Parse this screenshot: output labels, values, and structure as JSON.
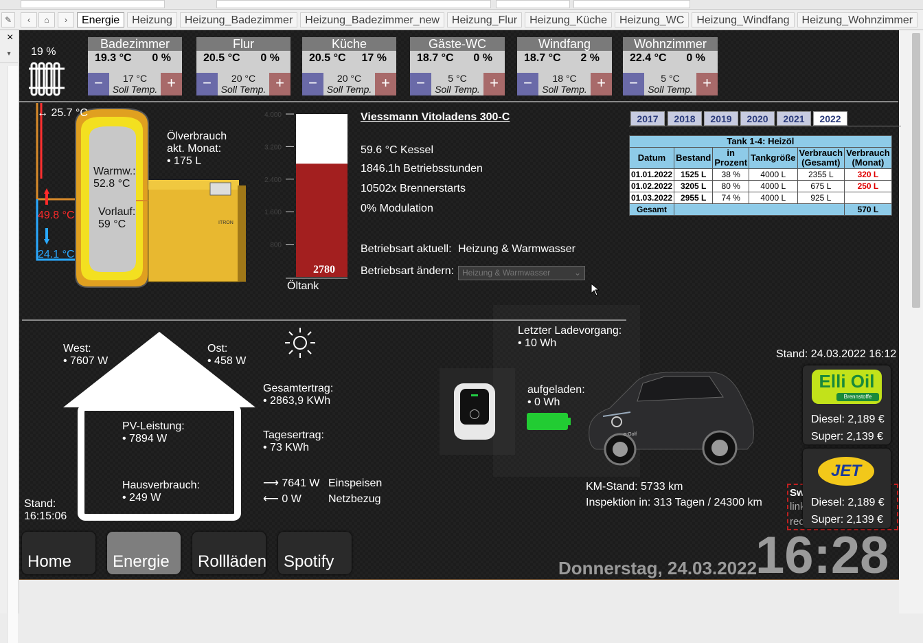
{
  "tabs": [
    "Energie",
    "Heizung",
    "Heizung_Badezimmer",
    "Heizung_Badezimmer_new",
    "Heizung_Flur",
    "Heizung_Küche",
    "Heizung_WC",
    "Heizung_Windfang",
    "Heizung_Wohnzimmer"
  ],
  "active_tab": "Energie",
  "close_glyph": "×",
  "heating": {
    "percent": "19 %"
  },
  "rooms": [
    {
      "name": "Badezimmer",
      "temp": "19.3 °C",
      "valve": "0 %",
      "soll": "17 °C",
      "soll_label": "Soll Temp."
    },
    {
      "name": "Flur",
      "temp": "20.5 °C",
      "valve": "0 %",
      "soll": "20 °C",
      "soll_label": "Soll Temp."
    },
    {
      "name": "Küche",
      "temp": "20.5 °C",
      "valve": "17 %",
      "soll": "20 °C",
      "soll_label": "Soll Temp."
    },
    {
      "name": "Gäste-WC",
      "temp": "18.7 °C",
      "valve": "0 %",
      "soll": "5 °C",
      "soll_label": "Soll Temp."
    },
    {
      "name": "Windfang",
      "temp": "18.7 °C",
      "valve": "2 %",
      "soll": "18 °C",
      "soll_label": "Soll Temp."
    },
    {
      "name": "Wohnzimmer",
      "temp": "22.4 °C",
      "valve": "0 %",
      "soll": "5 °C",
      "soll_label": "Soll Temp."
    }
  ],
  "boiler": {
    "top_temp": "↔ 25.7 °C",
    "oil_label": "Ölverbrauch",
    "oil_month": "akt. Monat:",
    "oil_value": "• 175 L",
    "warmw_label": "Warmw.:",
    "warmw_value": "52.8 °C",
    "vorlauf_label": "Vorlauf:",
    "vorlauf_value": "59 °C",
    "red_temp": "49.8 °C",
    "blue_temp": "24.1 °C",
    "brand": "ITRON"
  },
  "oiltank": {
    "level": 2780,
    "max": 4000,
    "label": "Öltank",
    "ticks": [
      "4.000",
      "3.200",
      "2.400",
      "1.600",
      "800"
    ]
  },
  "vitoladens": {
    "title": "Viessmann Vitoladens 300-C",
    "kessel": "59.6 °C Kessel",
    "stunden": "1846.1h Betriebsstunden",
    "starts": "10502x Brennerstarts",
    "modulation": "0% Modulation",
    "mode_label": "Betriebsart aktuell:",
    "mode_value": "Heizung & Warmwasser",
    "change_label": "Betriebsart ändern:",
    "change_value": "Heizung & Warmwasser"
  },
  "years": [
    "2017",
    "2018",
    "2019",
    "2020",
    "2021",
    "2022"
  ],
  "active_year": "2022",
  "tank_table": {
    "title": "Tank 1-4: Heizöl",
    "headers": [
      "Datum",
      "Bestand",
      "in Prozent",
      "Tankgröße",
      "Verbrauch (Gesamt)",
      "Verbrauch (Monat)"
    ],
    "rows": [
      [
        "01.01.2022",
        "1525 L",
        "38 %",
        "4000 L",
        "2355 L",
        "320 L"
      ],
      [
        "01.02.2022",
        "3205 L",
        "80 %",
        "4000 L",
        "675 L",
        "250 L"
      ],
      [
        "01.03.2022",
        "2955 L",
        "74 %",
        "4000 L",
        "925 L",
        ""
      ]
    ],
    "total_label": "Gesamt",
    "total_value": "570 L"
  },
  "pv": {
    "west_label": "West:",
    "west_value": "• 7607 W",
    "ost_label": "Ost:",
    "ost_value": "• 458 W",
    "pv_label": "PV-Leistung:",
    "pv_value": "• 7894 W",
    "haus_label": "Hausverbrauch:",
    "haus_value": "• 249 W",
    "gesamt_label": "Gesamtertrag:",
    "gesamt_value": "• 2863,9 KWh",
    "tages_label": "Tagesertrag:",
    "tages_value": "• 73 KWh",
    "einspeisen_value": "⟶ 7641 W",
    "einspeisen_label": "Einspeisen",
    "netz_value": "⟵ 0 W",
    "netz_label": "Netzbezug",
    "stand_label": "Stand:",
    "stand_value": "16:15:06"
  },
  "car": {
    "last_label": "Letzter Ladevorgang:",
    "last_value": "• 10 Wh",
    "charged_label": "aufgeladen:",
    "charged_value": "• 0 Wh",
    "km": "KM-Stand: 5733 km",
    "inspection": "Inspektion in: 313 Tagen / 24300 km",
    "badge": "e-Golf"
  },
  "fuel": {
    "stand": "Stand: 24.03.2022 16:12",
    "elli_logo": "Elli Oil",
    "elli_sub": "Brennstoffe",
    "elli_diesel": "Diesel: 2,189 €",
    "elli_super": "Super: 2,139 €",
    "jet_logo": "JET",
    "jet_diesel": "Diesel: 2,189 €",
    "jet_super": "Super: 2,139 €",
    "hidden_sw": "Sw",
    "hidden_l1": "link",
    "hidden_l2": "rec"
  },
  "nav": [
    "Home",
    "Energie",
    "Rollläden",
    "Spotify"
  ],
  "active_nav": "Energie",
  "date": "Donnerstag, 24.03.2022",
  "time": "16:28",
  "colors": {
    "hot": "#ff2a2a",
    "cold": "#2aa8ff",
    "tank": "#a31f1f",
    "accent_battery": "#22cc33"
  }
}
